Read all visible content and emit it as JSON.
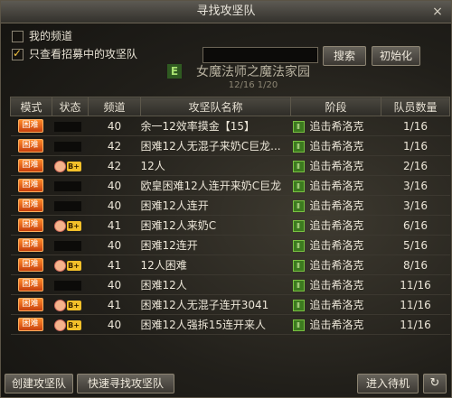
{
  "window": {
    "title": "寻找攻坚队",
    "close_icon": "×"
  },
  "filters": {
    "my_channel": "我的频道",
    "recruiting_only": "只查看招募中的攻坚队"
  },
  "search": {
    "input_value": "",
    "search_button": "搜索",
    "reset_button": "初始化"
  },
  "background_banner": {
    "title": "女魔法师之魔法家园",
    "sub": "12/16 1/20",
    "badge": "E"
  },
  "table": {
    "headers": [
      "模式",
      "状态",
      "频道",
      "攻坚队名称",
      "阶段",
      "队员数量"
    ],
    "rows": [
      {
        "mode": "困难",
        "status_badge": false,
        "channel": "40",
        "name": "余一12效率摸金【15】",
        "stage": "追击希洛克",
        "members": "1/16"
      },
      {
        "mode": "困难",
        "status_badge": false,
        "channel": "42",
        "name": "困难12人无混子来奶C巨龙...",
        "stage": "追击希洛克",
        "members": "1/16"
      },
      {
        "mode": "困难",
        "status_badge": true,
        "channel": "42",
        "name": "12人",
        "stage": "追击希洛克",
        "members": "2/16"
      },
      {
        "mode": "困难",
        "status_badge": false,
        "channel": "40",
        "name": "欧皇困难12人连开来奶C巨龙",
        "stage": "追击希洛克",
        "members": "3/16"
      },
      {
        "mode": "困难",
        "status_badge": false,
        "channel": "40",
        "name": "困难12人连开",
        "stage": "追击希洛克",
        "members": "3/16"
      },
      {
        "mode": "困难",
        "status_badge": true,
        "channel": "41",
        "name": "困难12人来奶C",
        "stage": "追击希洛克",
        "members": "6/16"
      },
      {
        "mode": "困难",
        "status_badge": false,
        "channel": "40",
        "name": "困难12连开",
        "stage": "追击希洛克",
        "members": "5/16"
      },
      {
        "mode": "困难",
        "status_badge": true,
        "channel": "41",
        "name": "12人困难",
        "stage": "追击希洛克",
        "members": "8/16"
      },
      {
        "mode": "困难",
        "status_badge": false,
        "channel": "40",
        "name": "困难12人",
        "stage": "追击希洛克",
        "members": "11/16"
      },
      {
        "mode": "困难",
        "status_badge": true,
        "channel": "41",
        "name": "困难12人无混子连开3041",
        "stage": "追击希洛克",
        "members": "11/16"
      },
      {
        "mode": "困难",
        "status_badge": true,
        "channel": "40",
        "name": "困难12人强拆15连开来人",
        "stage": "追击希洛克",
        "members": "11/16"
      }
    ]
  },
  "bottom": {
    "create": "创建攻坚队",
    "quick_find": "快速寻找攻坚队",
    "enter_wait": "进入待机",
    "refresh_icon": "↻"
  },
  "icons": {
    "status_icon_text": "B+",
    "stage_icon_text": "Ⅱ"
  },
  "colors": {
    "mode_tag": "#e8601a",
    "stage_icon": "#3c7a1f",
    "badge": "#f3c02a"
  }
}
